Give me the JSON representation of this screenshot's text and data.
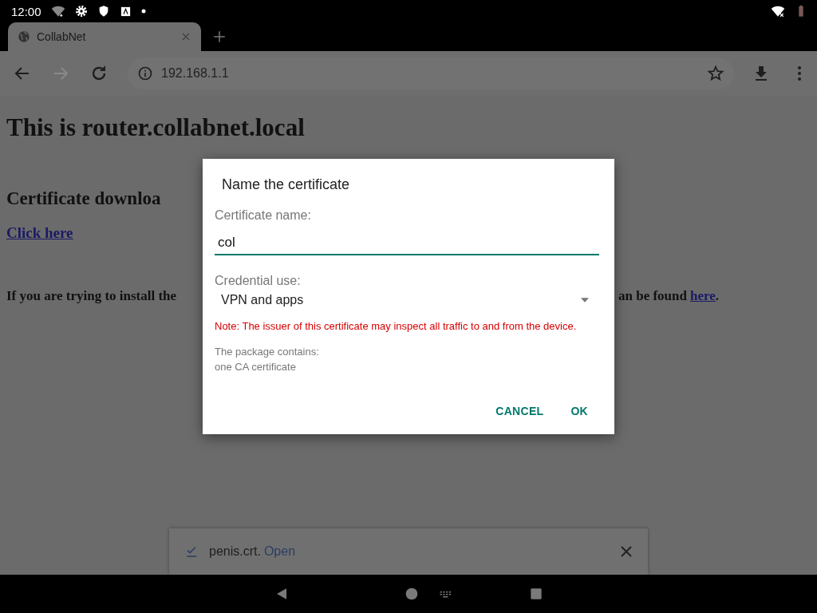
{
  "status_bar": {
    "time": "12:00"
  },
  "browser": {
    "tabs": [
      {
        "title": "CollabNet",
        "selected": true
      }
    ],
    "address": "192.168.1.1"
  },
  "page": {
    "heading": "This is router.collabnet.local",
    "subheading": "Certificate downloa",
    "link": "Click here",
    "note_left": "If you are trying to install the",
    "note_right": "an be found",
    "note_link": "here",
    "note_end": "."
  },
  "dialog": {
    "title": "Name the certificate",
    "name_label": "Certificate name:",
    "name_value": "col",
    "use_label": "Credential use:",
    "use_value": "VPN and apps",
    "warning": "Note: The issuer of this certificate may inspect all traffic to and from the device.",
    "package_label": "The package contains:",
    "package_item": "one CA certificate",
    "buttons": [
      "CANCEL",
      "OK"
    ]
  },
  "download_bar": {
    "file": "penis.crt.",
    "action": "Open"
  }
}
